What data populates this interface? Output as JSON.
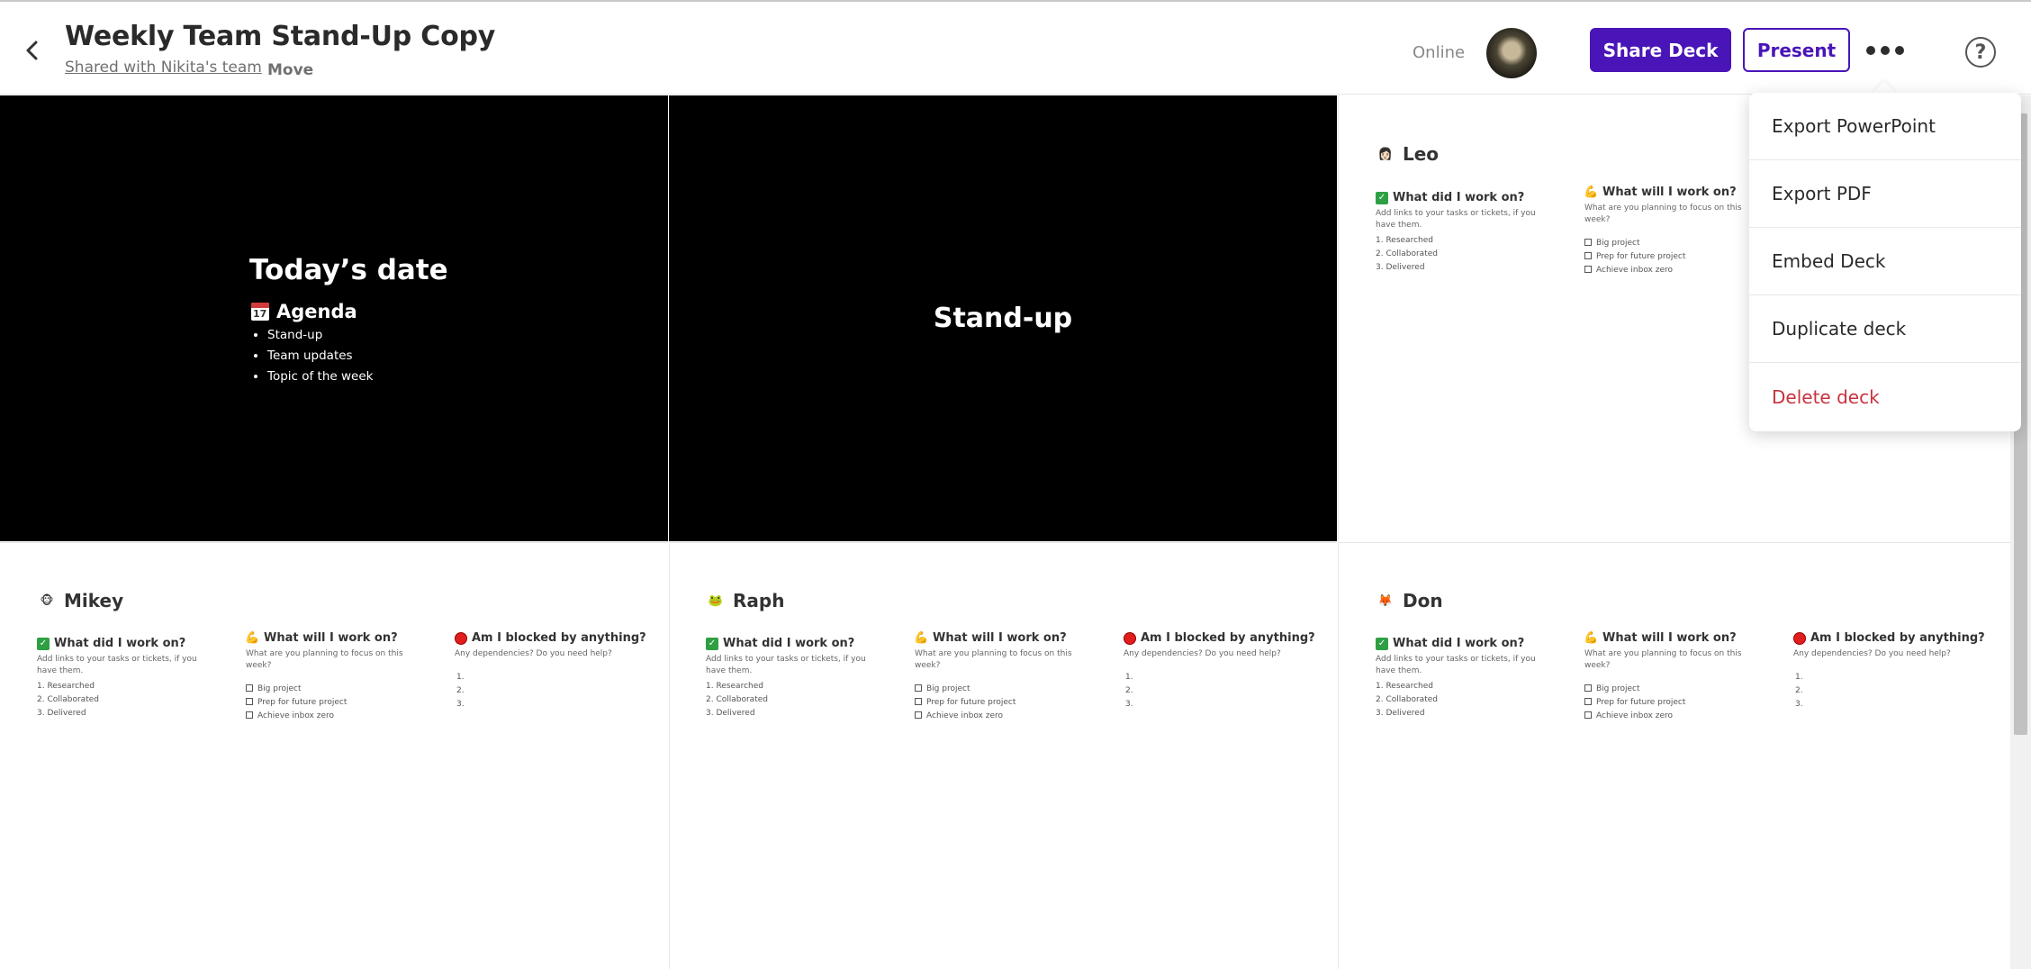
{
  "header": {
    "title": "Weekly Team Stand-Up Copy",
    "shared_link": "Shared with Nikita's team",
    "move_label": "Move",
    "status": "Online",
    "share_label": "Share Deck",
    "present_label": "Present",
    "help_label": "?"
  },
  "menu": {
    "items": [
      {
        "label": "Export PowerPoint"
      },
      {
        "label": "Export PDF"
      },
      {
        "label": "Embed Deck"
      },
      {
        "label": "Duplicate deck"
      },
      {
        "label": "Delete deck"
      }
    ]
  },
  "slides": {
    "intro": {
      "title": "Today’s date",
      "agenda_title": "Agenda",
      "agenda_items": [
        "Stand-up",
        "Team updates",
        "Topic of the week"
      ]
    },
    "standup": {
      "title": "Stand-up"
    },
    "people": [
      {
        "name": "Leo",
        "emoji": "👩🏻"
      },
      {
        "name": "Mikey",
        "emoji": "🐵"
      },
      {
        "name": "Raph",
        "emoji": "🐸"
      },
      {
        "name": "Don",
        "emoji": "🦊"
      }
    ],
    "columns": {
      "did": {
        "title": "What did I work on?",
        "desc": "Add links to your tasks or tickets, if you have them.",
        "items": [
          "1. Researched",
          "2. Collaborated",
          "3. Delivered"
        ]
      },
      "will": {
        "title": "What will I work on?",
        "desc": "What are you planning to focus on this week?",
        "items": [
          "Big project",
          "Prep for future project",
          "Achieve inbox zero"
        ]
      },
      "blocked": {
        "title": "Am I blocked by anything?",
        "desc": "Any dependencies? Do you need help?",
        "items": [
          "1.",
          "2.",
          "3."
        ]
      }
    }
  }
}
